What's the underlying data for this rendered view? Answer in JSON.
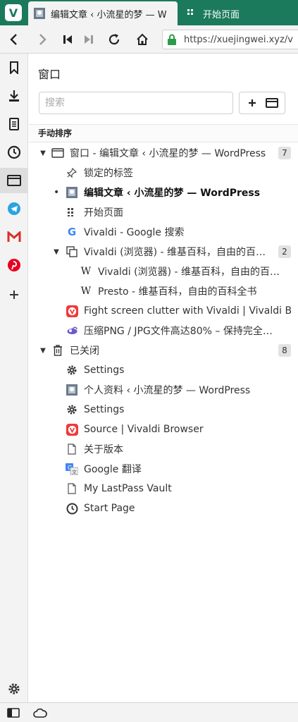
{
  "tabs": [
    {
      "title": "编辑文章 ‹ 小流星的梦 — W",
      "active": true
    },
    {
      "title": "开始页面",
      "active": false
    }
  ],
  "address": {
    "url": "https://xuejingwei.xyz/v"
  },
  "panel": {
    "title": "窗口",
    "search_placeholder": "搜索",
    "sort_label": "手动排序"
  },
  "tree": {
    "window": {
      "label": "窗口 - 编辑文章 ‹ 小流星的梦 — WordPress",
      "count": "7"
    },
    "pinned": {
      "label": "锁定的标签"
    },
    "tabs": [
      {
        "label": "编辑文章 ‹ 小流星的梦 — WordPress",
        "icon": "wordpress-icon",
        "active": true
      },
      {
        "label": "开始页面",
        "icon": "speed-dial-icon"
      },
      {
        "label": "Vivaldi - Google 搜索",
        "icon": "google-icon"
      }
    ],
    "stack": {
      "label": "Vivaldi (浏览器) - 维基百科，自由的百…",
      "count": "2"
    },
    "stack_tabs": [
      {
        "label": "Vivaldi (浏览器) - 维基百科，自由的百…",
        "icon": "wikipedia-icon"
      },
      {
        "label": "Presto - 维基百科，自由的百科全书",
        "icon": "wikipedia-icon"
      }
    ],
    "more_tabs": [
      {
        "label": "Fight screen clutter with Vivaldi | Vivaldi B…",
        "icon": "vivaldi-icon"
      },
      {
        "label": "压缩PNG / JPG文件高达80% – 保持完全…",
        "icon": "tinypng-icon"
      }
    ],
    "closed": {
      "label": "已关闭",
      "count": "8"
    },
    "closed_tabs": [
      {
        "label": "Settings",
        "icon": "gear-icon"
      },
      {
        "label": "个人资料 ‹ 小流星的梦 — WordPress",
        "icon": "wordpress-icon"
      },
      {
        "label": "Settings",
        "icon": "gear-icon"
      },
      {
        "label": "Source | Vivaldi Browser",
        "icon": "vivaldi-icon"
      },
      {
        "label": "关于版本",
        "icon": "page-icon"
      },
      {
        "label": "Google 翻译",
        "icon": "google-translate-icon"
      },
      {
        "label": "My LastPass Vault",
        "icon": "page-icon"
      },
      {
        "label": "Start Page",
        "icon": "clock-icon"
      }
    ]
  },
  "colors": {
    "brand": "#1b7a5b",
    "vivaldi_red": "#ef3939",
    "telegram": "#2aa3e0",
    "gmail": "#d93025",
    "pinterest": "#e60023"
  }
}
